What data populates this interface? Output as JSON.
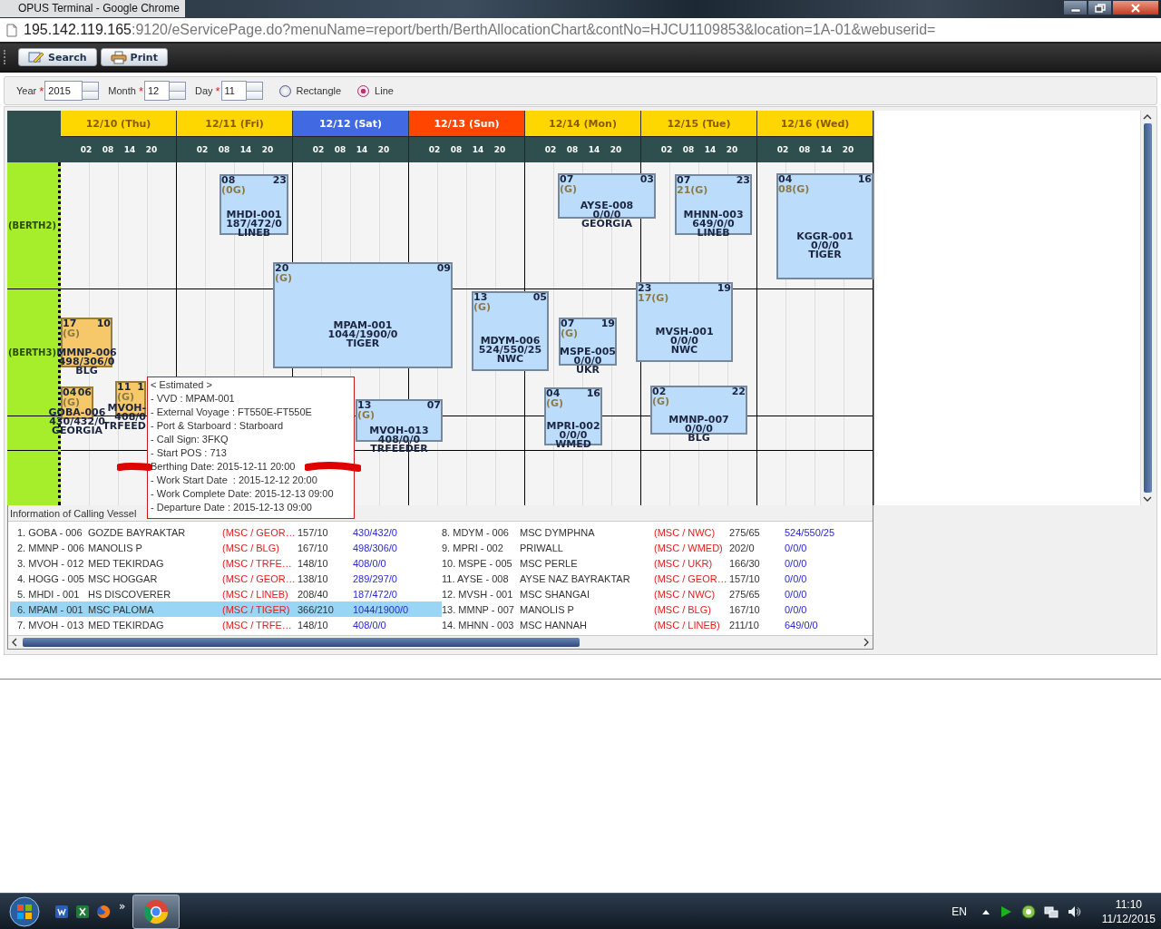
{
  "window": {
    "title": "OPUS Terminal - Google Chrome"
  },
  "address_bar": {
    "host": "195.142.119.165",
    "path": ":9120/eServicePage.do?menuName=report/berth/BerthAllocationChart&contNo=HJCU1109853&location=1A-01&webuserid="
  },
  "toolbar": {
    "buttons": [
      {
        "label": "Search",
        "kind": "search"
      },
      {
        "label": "Print",
        "kind": "print"
      }
    ]
  },
  "filters": {
    "fields": [
      {
        "label": "Year",
        "required_mark": "*",
        "value": "2015"
      },
      {
        "label": "Month",
        "required_mark": "*",
        "value": "12"
      },
      {
        "label": "Day",
        "required_mark": "*",
        "value": "11"
      }
    ],
    "view_options": [
      {
        "label": "Rectangle",
        "selected": false
      },
      {
        "label": "Line",
        "selected": true
      }
    ]
  },
  "chart": {
    "days": [
      {
        "label": "12/10 (Thu)",
        "kind": "weekday",
        "hours": [
          "02",
          "08",
          "14",
          "20"
        ]
      },
      {
        "label": "12/11 (Fri)",
        "kind": "weekday",
        "hours": [
          "02",
          "08",
          "14",
          "20"
        ]
      },
      {
        "label": "12/12 (Sat)",
        "kind": "saturday",
        "hours": [
          "02",
          "08",
          "14",
          "20"
        ]
      },
      {
        "label": "12/13 (Sun)",
        "kind": "sunday",
        "hours": [
          "02",
          "08",
          "14",
          "20"
        ]
      },
      {
        "label": "12/14 (Mon)",
        "kind": "weekday",
        "hours": [
          "02",
          "08",
          "14",
          "20"
        ]
      },
      {
        "label": "12/15 (Tue)",
        "kind": "weekday",
        "hours": [
          "02",
          "08",
          "14",
          "20"
        ]
      },
      {
        "label": "12/16 (Wed)",
        "kind": "weekday",
        "hours": [
          "02",
          "08",
          "14",
          "20"
        ]
      }
    ],
    "berths": [
      {
        "label": "(BERTH2)"
      },
      {
        "label": "(BERTH3)"
      }
    ],
    "vessels": [
      {
        "start": "08",
        "end": "23",
        "window": "(0G)",
        "code": "MHDI-001",
        "cargo": "187/472/0",
        "route": "LINEB",
        "color": "#bcdcfb"
      },
      {
        "start": "20",
        "end": "09",
        "window": "(G)",
        "code": "MPAM-001",
        "cargo": "1044/1900/0",
        "route": "TIGER",
        "color": "#bcdcfb"
      },
      {
        "start": "17",
        "end": "10",
        "window": "(G)",
        "code": "MMNP-006",
        "cargo": "498/306/0",
        "route": "BLG",
        "color": "#f6c86a"
      },
      {
        "start": "04",
        "end": "06",
        "window": "(G)",
        "code": "GOBA-006",
        "cargo": "430/432/0",
        "route": "GEORGIA",
        "color": "#f6c86a"
      },
      {
        "start": "11",
        "end": "1",
        "window": "(G)",
        "code": "MVOH-",
        "cargo": "408/0",
        "route": "TRFEED",
        "color": "#f6c86a"
      },
      {
        "start": "13",
        "end": "07",
        "window": "(G)",
        "code": "MVOH-013",
        "cargo": "408/0/0",
        "route": "TRFEEDER",
        "color": "#bcdcfb"
      },
      {
        "start": "13",
        "end": "05",
        "window": "(G)",
        "code": "MDYM-006",
        "cargo": "524/550/25",
        "route": "NWC",
        "color": "#bcdcfb"
      },
      {
        "start": "07",
        "end": "03",
        "window": "(G)",
        "code": "AYSE-008",
        "cargo": "0/0/0",
        "route": "GEORGIA",
        "color": "#bcdcfb"
      },
      {
        "start": "07",
        "end": "19",
        "window": "(G)",
        "code": "MSPE-005",
        "cargo": "0/0/0",
        "route": "UKR",
        "color": "#bcdcfb"
      },
      {
        "start": "04",
        "end": "16",
        "window": "(G)",
        "code": "MPRI-002",
        "cargo": "0/0/0",
        "route": "WMED",
        "color": "#bcdcfb"
      },
      {
        "start": "07",
        "end": "23",
        "window": "21(G)",
        "code": "MHNN-003",
        "cargo": "649/0/0",
        "route": "LINEB",
        "color": "#bcdcfb"
      },
      {
        "start": "23",
        "end": "19",
        "window": "17(G)",
        "code": "MVSH-001",
        "cargo": "0/0/0",
        "route": "NWC",
        "color": "#bcdcfb"
      },
      {
        "start": "02",
        "end": "22",
        "window": "(G)",
        "code": "MMNP-007",
        "cargo": "0/0/0",
        "route": "BLG",
        "color": "#bcdcfb"
      },
      {
        "start": "04",
        "end": "16",
        "window": "08(G)",
        "code": "KGGR-001",
        "cargo": "0/0/0",
        "route": "TIGER",
        "color": "#bcdcfb"
      }
    ]
  },
  "tooltip": {
    "title": "< Estimated >",
    "lines": [
      "- VVD : MPAM-001",
      "- External Voyage : FT550E-FT550E",
      "- Port & Starboard : Starboard",
      "- Call Sign: 3FKQ",
      "- Start POS : 713",
      "Berthing Date: 2015-12-11 20:00",
      "- Work Start Date  : 2015-12-12 20:00",
      "- Work Complete Date: 2015-12-13 09:00",
      "- Departure Date : 2015-12-13 09:00"
    ]
  },
  "vessel_list": {
    "title": "Information of Calling Vessel",
    "rows": [
      {
        "number": "1. GOBA - 006",
        "vessel": "GOZDE BAYRAKTAR",
        "route": "(MSC / GEOR…",
        "size": "157/10",
        "cargo": "430/432/0",
        "selected": false
      },
      {
        "number": "2. MMNP - 006",
        "vessel": "MANOLIS P",
        "route": "(MSC / BLG)",
        "size": "167/10",
        "cargo": "498/306/0",
        "selected": false
      },
      {
        "number": "3. MVOH - 012",
        "vessel": "MED TEKIRDAG",
        "route": "(MSC / TRFE…",
        "size": "148/10",
        "cargo": "408/0/0",
        "selected": false
      },
      {
        "number": "4. HOGG - 005",
        "vessel": "MSC HOGGAR",
        "route": "(MSC / GEOR…",
        "size": "138/10",
        "cargo": "289/297/0",
        "selected": false
      },
      {
        "number": "5. MHDI - 001",
        "vessel": "HS DISCOVERER",
        "route": "(MSC / LINEB)",
        "size": "208/40",
        "cargo": "187/472/0",
        "selected": false
      },
      {
        "number": "6. MPAM - 001",
        "vessel": "MSC PALOMA",
        "route": "(MSC / TIGER)",
        "size": "366/210",
        "cargo": "1044/1900/0",
        "selected": true
      },
      {
        "number": "7. MVOH - 013",
        "vessel": "MED TEKIRDAG",
        "route": "(MSC / TRFE…",
        "size": "148/10",
        "cargo": "408/0/0",
        "selected": false
      },
      {
        "number": "8. MDYM - 006",
        "vessel": "MSC DYMPHNA",
        "route": "(MSC / NWC)",
        "size": "275/65",
        "cargo": "524/550/25",
        "selected": false
      },
      {
        "number": "9. MPRI - 002",
        "vessel": "PRIWALL",
        "route": "(MSC / WMED)",
        "size": "202/0",
        "cargo": "0/0/0",
        "selected": false
      },
      {
        "number": "10. MSPE - 005",
        "vessel": "MSC PERLE",
        "route": "(MSC / UKR)",
        "size": "166/30",
        "cargo": "0/0/0",
        "selected": false
      },
      {
        "number": "11. AYSE - 008",
        "vessel": "AYSE NAZ BAYRAKTAR",
        "route": "(MSC / GEOR…",
        "size": "157/10",
        "cargo": "0/0/0",
        "selected": false
      },
      {
        "number": "12. MVSH - 001",
        "vessel": "MSC SHANGAI",
        "route": "(MSC / NWC)",
        "size": "275/65",
        "cargo": "0/0/0",
        "selected": false
      },
      {
        "number": "13. MMNP - 007",
        "vessel": "MANOLIS P",
        "route": "(MSC / BLG)",
        "size": "167/10",
        "cargo": "0/0/0",
        "selected": false
      },
      {
        "number": "14. MHNN - 003",
        "vessel": "MSC HANNAH",
        "route": "(MSC / LINEB)",
        "size": "211/10",
        "cargo": "649/0/0",
        "selected": false
      }
    ]
  },
  "taskbar": {
    "overflow": "»",
    "language": "EN",
    "time": "11:10",
    "date": "11/12/2015"
  }
}
